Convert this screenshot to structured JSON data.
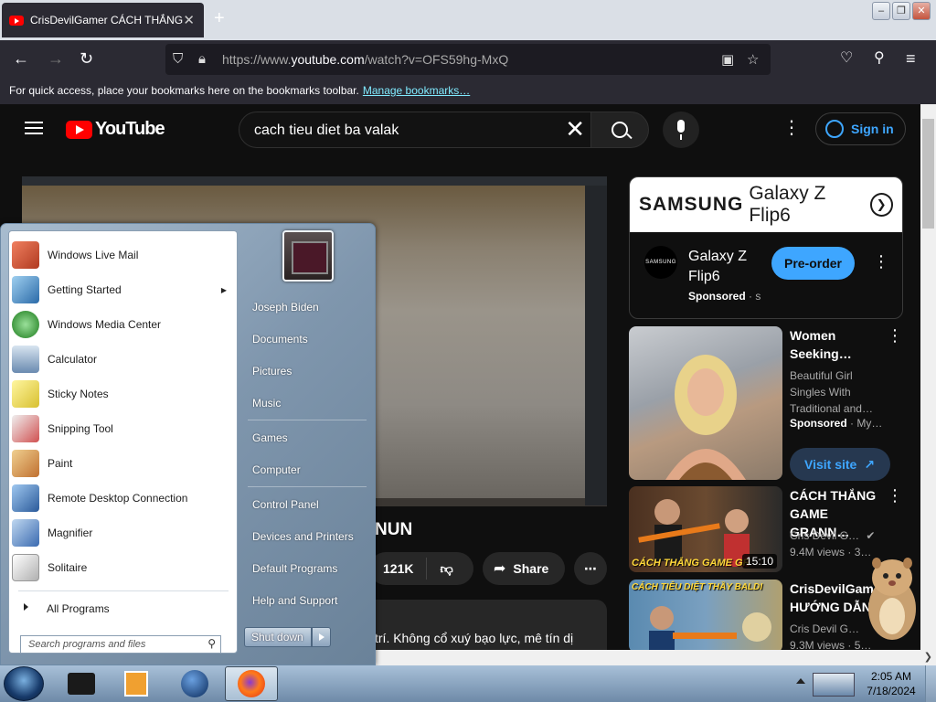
{
  "browser": {
    "tab_title": "CrisDevilGamer CÁCH THẮNG",
    "new_tab": "+",
    "url_prefix": "https://www.",
    "url_host": "youtube.com",
    "url_path": "/watch?v=OFS59hg-MxQ",
    "bookmarks_text": "For quick access, place your bookmarks here on the bookmarks toolbar.",
    "manage_bookmarks": "Manage bookmarks…"
  },
  "youtube": {
    "logo_text": "YouTube",
    "search_value": "cach tieu diet ba valak",
    "sign_in": "Sign in",
    "video_title_fragment": "NUN",
    "likes": "121K",
    "share": "Share",
    "description_fragment": "trí. Không cổ xuý bạo lực, mê tín dị"
  },
  "ad": {
    "banner_brand": "SAMSUNG",
    "banner_product": "Galaxy Z Flip6",
    "logo": "SAMSUNG",
    "name": "Galaxy Z Flip6",
    "sponsored": "Sponsored",
    "sponsored_extra": "· s",
    "cta": "Pre-order"
  },
  "related": [
    {
      "title": "Women Seeking…",
      "line1": "Beautiful Girl",
      "line2": "Singles With",
      "line3": "Traditional and…",
      "sponsored": "Sponsored",
      "extra": "· My…",
      "cta": "Visit site"
    },
    {
      "title": "CÁCH THẮNG GAME GRANN…",
      "channel": "Cris Devil G…",
      "meta": "9.4M views",
      "meta_extra": "· 3…",
      "duration": "15:10",
      "thumb_text": "CÁCH THẮNG GAME GR"
    },
    {
      "title": "CrisDevilGam… HƯỚNG DẪN",
      "channel": "Cris Devil G…",
      "meta": "9.3M views",
      "meta_extra": "· 5…",
      "thumb_text": "CÁCH TIÊU DIỆT THẦY BALDI"
    }
  ],
  "start_menu": {
    "programs": [
      {
        "label": "Windows Live Mail",
        "icon": "mail-icon",
        "color": "#c4452a"
      },
      {
        "label": "Getting Started",
        "icon": "getting-started-icon",
        "color": "#3a8ad0",
        "submenu": true
      },
      {
        "label": "Windows Media Center",
        "icon": "media-center-icon",
        "color": "#2a8a2a"
      },
      {
        "label": "Calculator",
        "icon": "calculator-icon",
        "color": "#6a8ab0"
      },
      {
        "label": "Sticky Notes",
        "icon": "sticky-notes-icon",
        "color": "#e8d84a"
      },
      {
        "label": "Snipping Tool",
        "icon": "scissors-icon",
        "color": "#d05050"
      },
      {
        "label": "Paint",
        "icon": "paint-icon",
        "color": "#d89a40"
      },
      {
        "label": "Remote Desktop Connection",
        "icon": "remote-desktop-icon",
        "color": "#3a6ab0"
      },
      {
        "label": "Magnifier",
        "icon": "magnifier-icon",
        "color": "#4a7ac0"
      },
      {
        "label": "Solitaire",
        "icon": "solitaire-icon",
        "color": "#e0e0e0"
      }
    ],
    "all_programs": "All Programs",
    "search_placeholder": "Search programs and files",
    "right_links": [
      "Joseph Biden",
      "Documents",
      "Pictures",
      "Music",
      "Games",
      "Computer",
      "Control Panel",
      "Devices and Printers",
      "Default Programs",
      "Help and Support"
    ],
    "shutdown": "Shut down"
  },
  "taskbar": {
    "time": "2:05 AM",
    "date": "7/18/2024"
  }
}
